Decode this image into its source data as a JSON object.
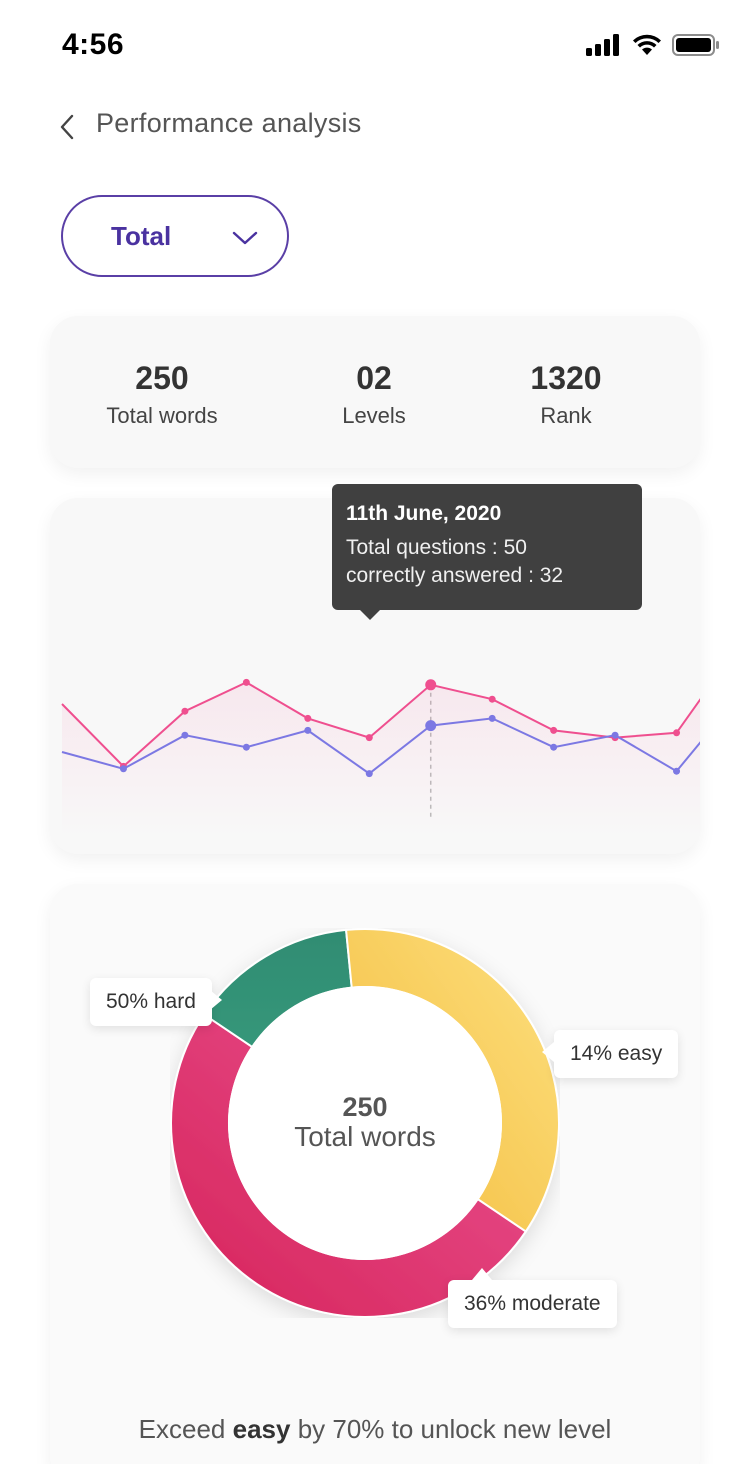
{
  "status_bar": {
    "time": "4:56",
    "icons": [
      "signal-icon",
      "wifi-icon",
      "battery-icon"
    ]
  },
  "nav": {
    "title": "Performance analysis",
    "back_icon": "chevron-left-icon"
  },
  "filter": {
    "selected": "Total",
    "icon": "chevron-down-icon"
  },
  "stats": [
    {
      "value": "250",
      "label": "Total words"
    },
    {
      "value": "02",
      "label": "Levels"
    },
    {
      "value": "1320",
      "label": "Rank"
    }
  ],
  "tooltip": {
    "date": "11th June, 2020",
    "line1": "Total questions : 50",
    "line2": "correctly answered : 32"
  },
  "chart_data": [
    {
      "type": "line",
      "series": [
        {
          "values": [
            50,
            24,
            47,
            59,
            44,
            36,
            58,
            52,
            39,
            36,
            38,
            74
          ]
        },
        {
          "values": [
            30,
            23,
            37,
            32,
            39,
            21,
            41,
            44,
            32,
            37,
            22,
            53
          ]
        }
      ],
      "highlight_index": 6,
      "colors": [
        "#ef4f8f",
        "#7c78e3"
      ]
    },
    {
      "type": "pie",
      "center_value": "250",
      "center_label": "Total words",
      "slices": [
        {
          "label": "50% hard",
          "value": 50,
          "color": "#e0346c"
        },
        {
          "label": "14% easy",
          "value": 14,
          "color": "#2f8c72"
        },
        {
          "label": "36% moderate",
          "value": 36,
          "color": "#f6c54f"
        }
      ]
    }
  ],
  "footer": {
    "prefix": "Exceed ",
    "emphasis": "easy",
    "suffix": " by 70% to unlock new level"
  }
}
